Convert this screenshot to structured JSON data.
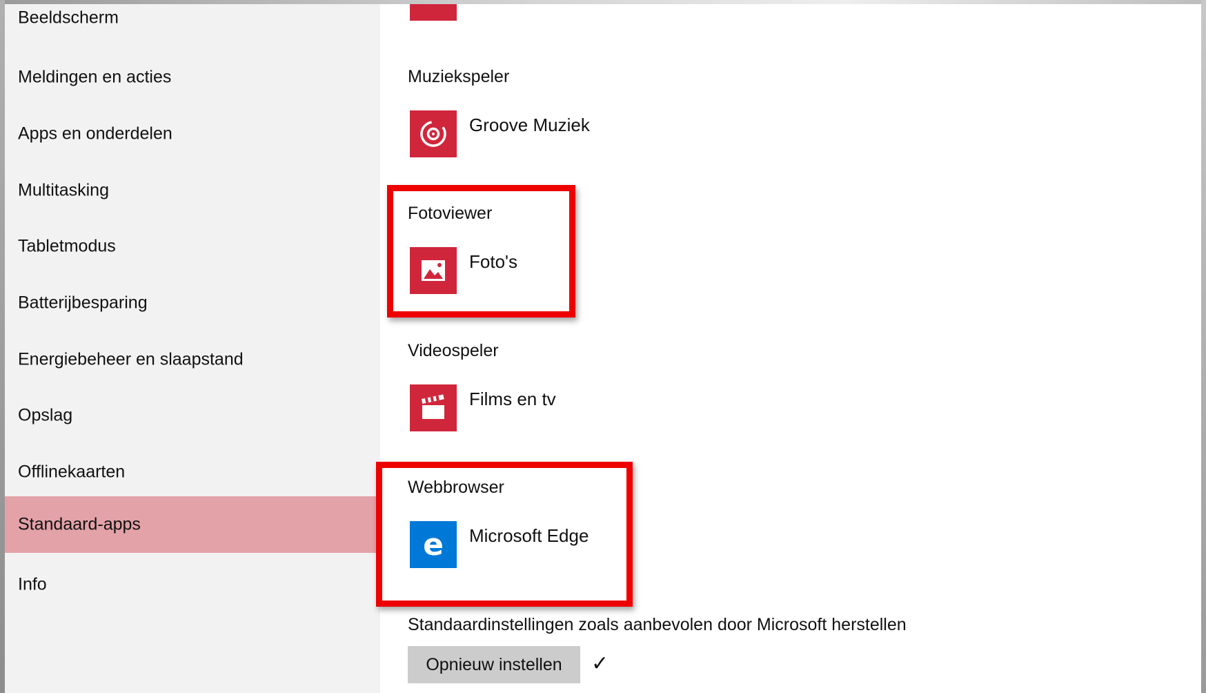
{
  "sidebar": {
    "items": [
      {
        "label": "Beeldscherm",
        "active": false
      },
      {
        "label": "Meldingen en acties",
        "active": false
      },
      {
        "label": "Apps en onderdelen",
        "active": false
      },
      {
        "label": "Multitasking",
        "active": false
      },
      {
        "label": "Tabletmodus",
        "active": false
      },
      {
        "label": "Batterijbesparing",
        "active": false
      },
      {
        "label": "Energiebeheer en slaapstand",
        "active": false
      },
      {
        "label": "Opslag",
        "active": false
      },
      {
        "label": "Offlinekaarten",
        "active": false
      },
      {
        "label": "Standaard-apps",
        "active": true
      },
      {
        "label": "Info",
        "active": false
      }
    ]
  },
  "main": {
    "sections": [
      {
        "title": "Muziekspeler",
        "app": "Groove Muziek",
        "icon": "groove-music-icon",
        "highlighted": false
      },
      {
        "title": "Fotoviewer",
        "app": "Foto's",
        "icon": "photos-icon",
        "highlighted": true
      },
      {
        "title": "Videospeler",
        "app": "Films en tv",
        "icon": "films-tv-icon",
        "highlighted": false
      },
      {
        "title": "Webbrowser",
        "app": "Microsoft Edge",
        "icon": "edge-icon",
        "highlighted": true
      }
    ],
    "reset": {
      "label": "Standaardinstellingen zoals aanbevolen door Microsoft herstellen",
      "button": "Opnieuw instellen",
      "status_icon": "checkmark-icon"
    }
  },
  "colors": {
    "accent": "#d0263b",
    "active_nav": "#e3a2a8",
    "edge_blue": "#0078d7",
    "highlight_red": "#ee0000"
  }
}
